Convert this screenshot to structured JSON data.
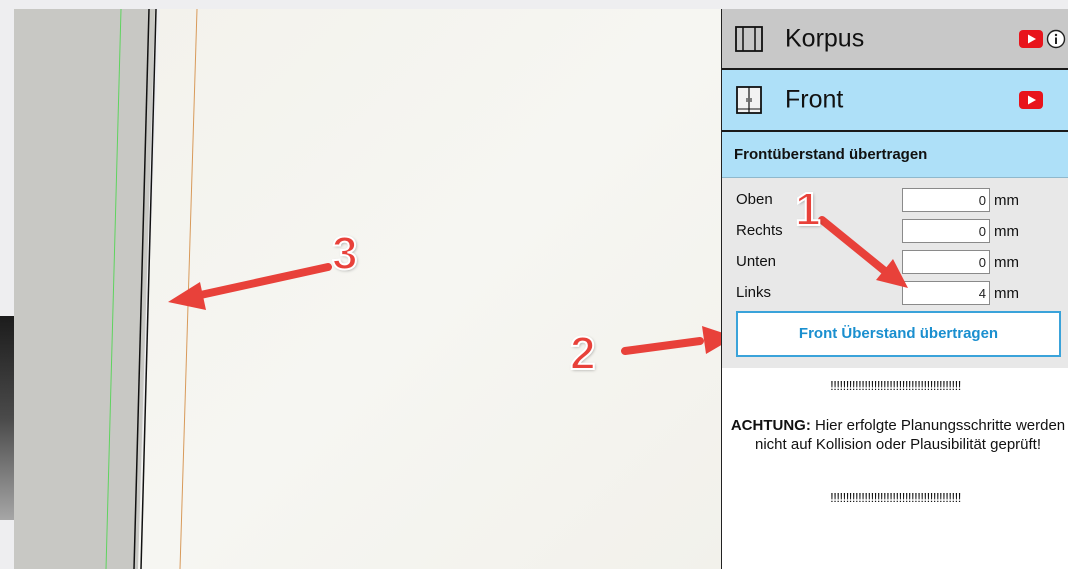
{
  "sections": {
    "korpus": {
      "title": "Korpus",
      "youtube_icon": "youtube-icon",
      "info_icon": "info-icon",
      "icon": "cabinet-icon"
    },
    "front": {
      "title": "Front",
      "youtube_icon": "youtube-icon",
      "icon": "front-door-icon"
    }
  },
  "front_overhang": {
    "header": "Frontüberstand übertragen",
    "fields": [
      {
        "label": "Oben",
        "value": "0",
        "unit": "mm"
      },
      {
        "label": "Rechts",
        "value": "0",
        "unit": "mm"
      },
      {
        "label": "Unten",
        "value": "0",
        "unit": "mm"
      },
      {
        "label": "Links",
        "value": "4",
        "unit": "mm"
      }
    ],
    "apply_button": "Front Überstand übertragen"
  },
  "warning": {
    "bang_line": "!!!!!!!!!!!!!!!!!!!!!!!!!!!!!!!!!!!!!!!!!!",
    "label": "ACHTUNG:",
    "text": " Hier erfolgte Planungsschritte werden nicht auf Kollision oder Plausibilität geprüft!"
  },
  "annotations": [
    "1",
    "2",
    "3"
  ],
  "colors": {
    "accent_blue": "#aee0f8",
    "button_blue": "#1a8fcf",
    "arrow_red": "#e8413a",
    "youtube_red": "#e8141c"
  }
}
